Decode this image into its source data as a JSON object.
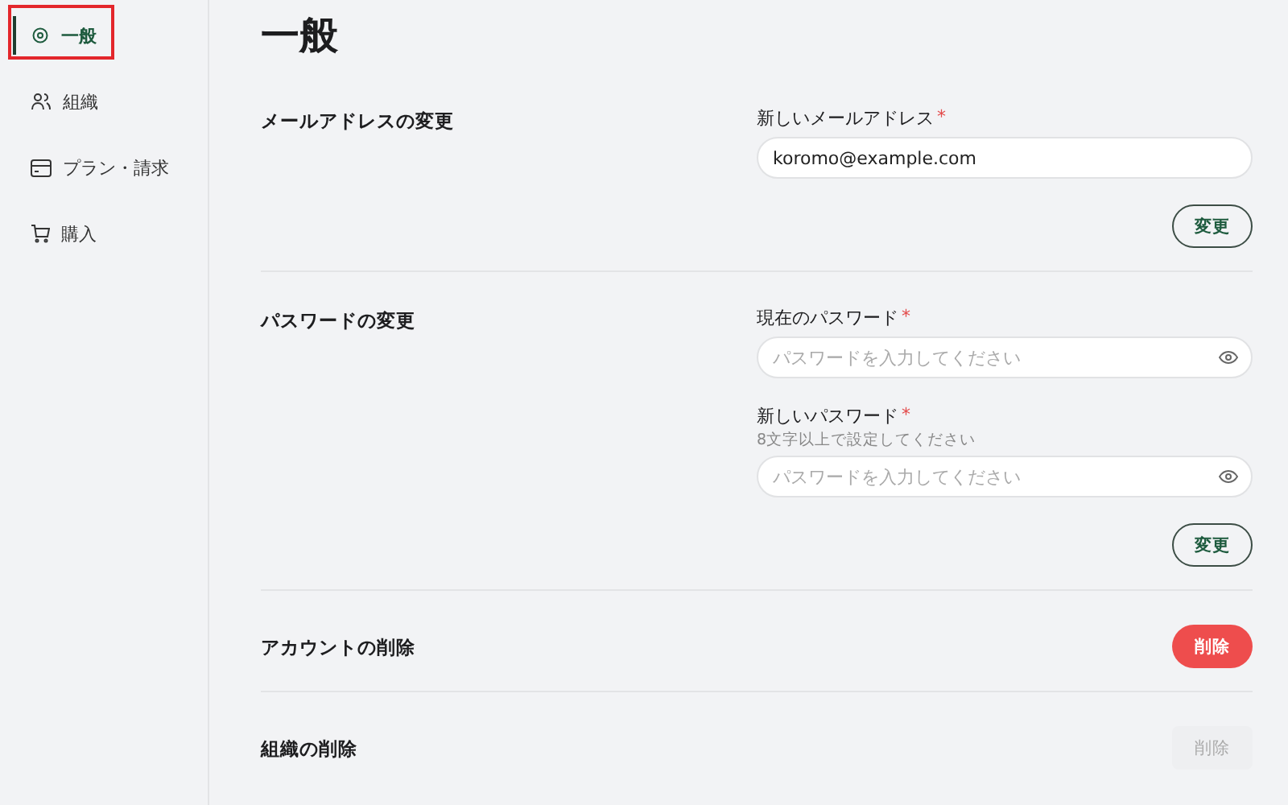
{
  "sidebar": {
    "items": [
      {
        "label": "一般",
        "selected": true,
        "annotated": true
      },
      {
        "label": "組織",
        "selected": false,
        "annotated": false
      },
      {
        "label": "プラン・請求",
        "selected": false,
        "annotated": false
      },
      {
        "label": "購入",
        "selected": false,
        "annotated": false
      }
    ]
  },
  "page_title": "一般",
  "sections": [
    {
      "kind": "form",
      "title": "メールアドレスの変更",
      "fields": [
        {
          "kind": "text",
          "label": "新しいメールアドレス",
          "required_mark": "*",
          "value": "koromo@example.com"
        }
      ],
      "button": {
        "label": "変更",
        "kind": "outline"
      }
    },
    {
      "kind": "form",
      "title": "パスワードの変更",
      "fields": [
        {
          "kind": "password",
          "label": "現在のパスワード",
          "required_mark": "*",
          "placeholder": "パスワードを入力してください"
        },
        {
          "kind": "password",
          "label": "新しいパスワード",
          "required_mark": "*",
          "hint": "8文字以上で設定してください",
          "placeholder": "パスワードを入力してください"
        }
      ],
      "button": {
        "label": "変更",
        "kind": "outline"
      }
    },
    {
      "kind": "action",
      "title": "アカウントの削除",
      "button": {
        "label": "削除",
        "kind": "danger",
        "disabled": false
      }
    },
    {
      "kind": "action",
      "title": "組織の削除",
      "button": {
        "label": "削除",
        "kind": "danger",
        "disabled": true
      }
    }
  ]
}
